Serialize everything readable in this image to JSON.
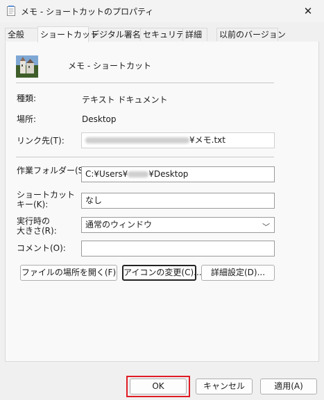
{
  "window": {
    "title": "メモ - ショートカットのプロパティ"
  },
  "tabs": [
    {
      "label": "全般",
      "active": false
    },
    {
      "label": "ショートカット",
      "active": true
    },
    {
      "label": "デジタル署名",
      "active": false
    },
    {
      "label": "セキュリティ",
      "active": false
    },
    {
      "label": "詳細",
      "active": false
    },
    {
      "label": "以前のバージョン",
      "active": false
    }
  ],
  "shortcut": {
    "name": "メモ - ショートカット",
    "type_label": "種類:",
    "type_value": "テキスト ドキュメント",
    "location_label": "場所:",
    "location_value": "Desktop",
    "target_label": "リンク先(T):",
    "target_suffix": "¥メモ.txt",
    "start_in_label": "作業フォルダー(S):",
    "start_in_prefix": "C:¥Users¥",
    "start_in_suffix": "¥Desktop",
    "shortcut_key_label": "ショートカット\nキー(K):",
    "shortcut_key_value": "なし",
    "run_label": "実行時の\n大きさ(R):",
    "run_value": "通常のウィンドウ",
    "comment_label": "コメント(O):",
    "comment_value": ""
  },
  "buttons": {
    "open_location": "ファイルの場所を開く(F)",
    "change_icon": "アイコンの変更(C)...",
    "advanced": "詳細設定(D)...",
    "ok": "OK",
    "cancel": "キャンセル",
    "apply": "適用(A)"
  },
  "colors": {
    "highlight": "#e01c24"
  }
}
